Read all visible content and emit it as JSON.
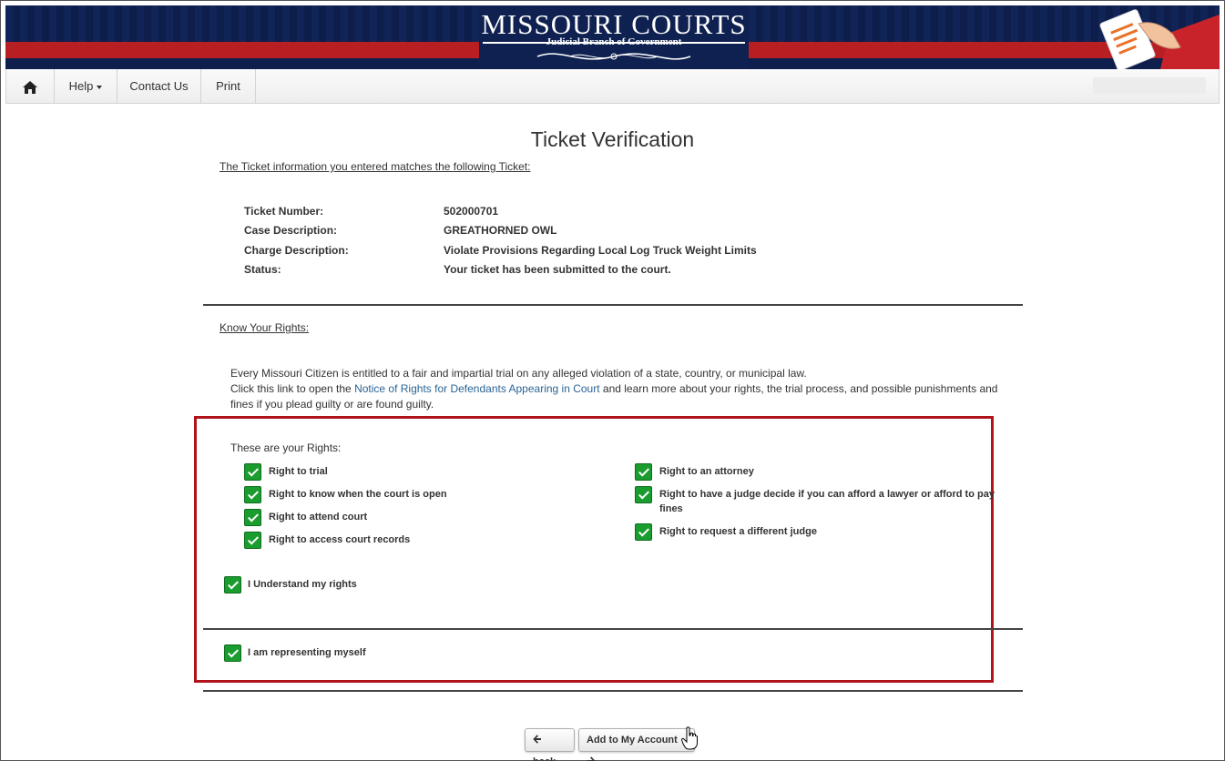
{
  "header": {
    "logo_title": "MISSOURI COURTS",
    "logo_subtitle": "Judicial Branch of Government"
  },
  "nav": {
    "home_icon": "home-icon",
    "help": "Help",
    "contact": "Contact Us",
    "print": "Print"
  },
  "page": {
    "title": "Ticket Verification",
    "match_heading": "The Ticket information you entered matches the following Ticket:",
    "ticket": [
      {
        "label": "Ticket Number:",
        "value": "502000701"
      },
      {
        "label": "Case Description:",
        "value": "GREATHORNED OWL"
      },
      {
        "label": "Charge Description:",
        "value": "Violate Provisions Regarding Local Log Truck Weight Limits"
      },
      {
        "label": "Status:",
        "value": "Your ticket has been submitted to the court."
      }
    ],
    "rights_heading": "Know Your Rights:",
    "para_line1": "Every Missouri Citizen is entitled to a fair and impartial trial on any alleged violation of a state, country, or municipal law.",
    "para_pre_link": "Click this link to open the ",
    "para_link": "Notice of Rights for Defendants Appearing in Court",
    "para_post_link": " and learn more about your rights, the trial process, and possible punishments and fines if you plead guilty or are found guilty.",
    "rights_label": "These are your Rights:",
    "rights_left": [
      "Right to trial",
      "Right to know when the court is open",
      "Right to attend court",
      "Right to access court records"
    ],
    "rights_right": [
      "Right to an attorney",
      "Right to have a judge decide if you can afford a lawyer or afford to pay fines",
      "Right to request a different judge"
    ],
    "understand": "I Understand my rights",
    "representing": "I am representing myself",
    "back_label": "back",
    "add_label": "Add to My Account"
  },
  "colors": {
    "navy": "#0f1f4d",
    "red": "#b81f23",
    "check_green": "#1a9c2f",
    "highlight_red": "#b0131a",
    "link": "#2a6496"
  }
}
